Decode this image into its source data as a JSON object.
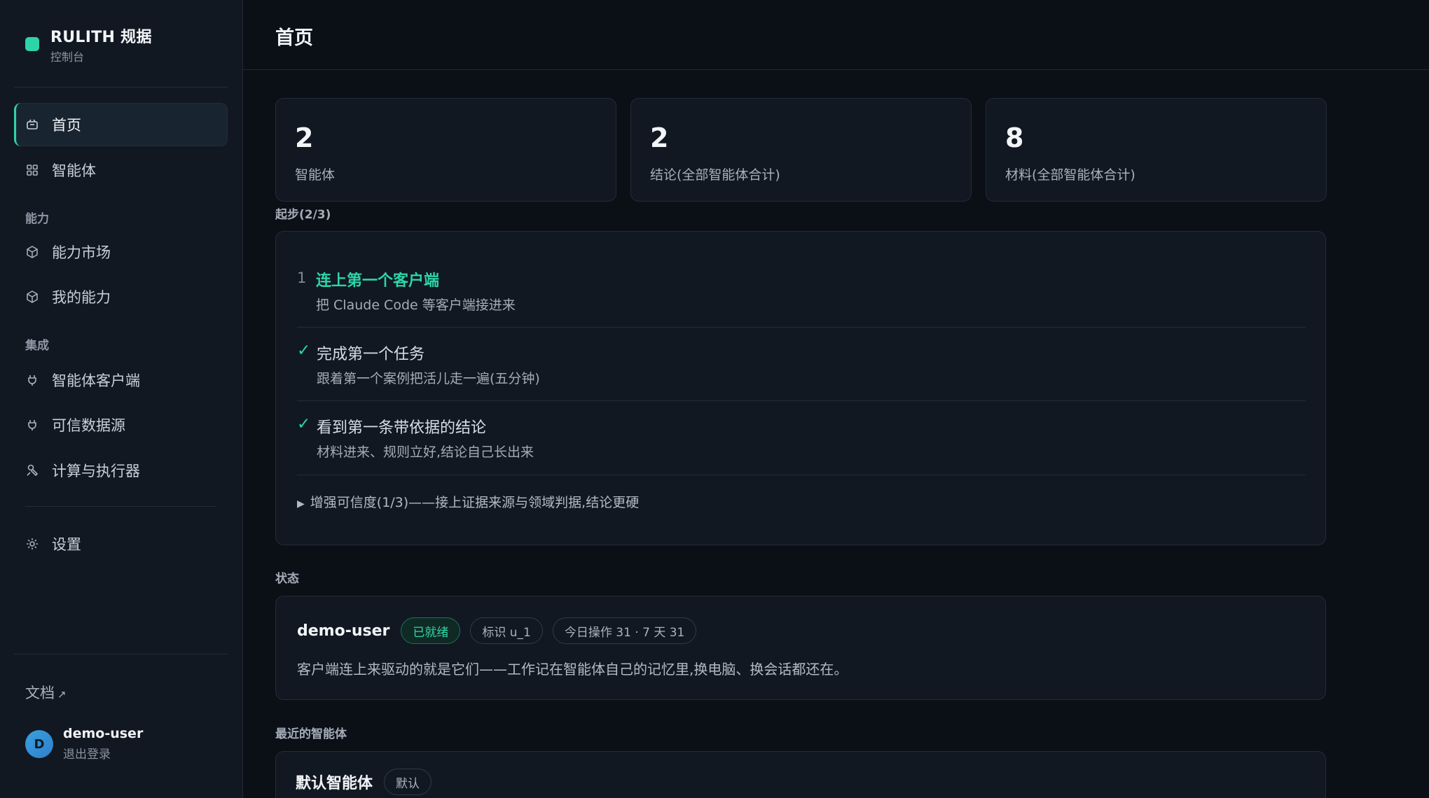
{
  "brand": {
    "title": "RULITH 规据",
    "subtitle": "控制台",
    "accent": "#2dd4a9"
  },
  "nav": {
    "home": {
      "label": "首页",
      "icon": "home-icon"
    },
    "agents": {
      "label": "智能体",
      "icon": "grid-icon"
    },
    "section_ability": "能力",
    "market": {
      "label": "能力市场",
      "icon": "cube-icon"
    },
    "my_abilities": {
      "label": "我的能力",
      "icon": "cube-icon"
    },
    "section_integration": "集成",
    "agent_clients": {
      "label": "智能体客户端",
      "icon": "plug-icon"
    },
    "data_sources": {
      "label": "可信数据源",
      "icon": "plug-icon"
    },
    "compute": {
      "label": "计算与执行器",
      "icon": "wrench-icon"
    },
    "settings": {
      "label": "设置",
      "icon": "gear-icon"
    }
  },
  "sidebar_footer": {
    "docs": "文档",
    "docs_arrow": "↗",
    "avatar_letter": "D",
    "user_name": "demo-user",
    "logout": "退出登录"
  },
  "page": {
    "title": "首页"
  },
  "stats": [
    {
      "value": "2",
      "label": "智能体"
    },
    {
      "value": "2",
      "label": "结论(全部智能体合计)"
    },
    {
      "value": "8",
      "label": "材料(全部智能体合计)"
    }
  ],
  "onboarding": {
    "title": "起步(2/3)",
    "steps": [
      {
        "marker": "1",
        "title": "连上第一个客户端",
        "desc": "把 Claude Code 等客户端接进来",
        "done": false
      },
      {
        "marker": "✓",
        "title": "完成第一个任务",
        "desc": "跟着第一个案例把活儿走一遍(五分钟)",
        "done": true
      },
      {
        "marker": "✓",
        "title": "看到第一条带依据的结论",
        "desc": "材料进来、规则立好,结论自己长出来",
        "done": true
      }
    ],
    "expand_triangle": "▶",
    "expand_label": "增强可信度(1/3)——接上证据来源与领域判据,结论更硬"
  },
  "status": {
    "title": "状态",
    "user": "demo-user",
    "badge_ready": "已就绪",
    "badge_id": "标识 u_1",
    "badge_ops": "今日操作 31 · 7 天 31",
    "description": "客户端连上来驱动的就是它们——工作记在智能体自己的记忆里,换电脑、换会话都还在。"
  },
  "recent": {
    "title": "最近的智能体",
    "agent_name": "默认智能体",
    "agent_badge": "默认"
  }
}
